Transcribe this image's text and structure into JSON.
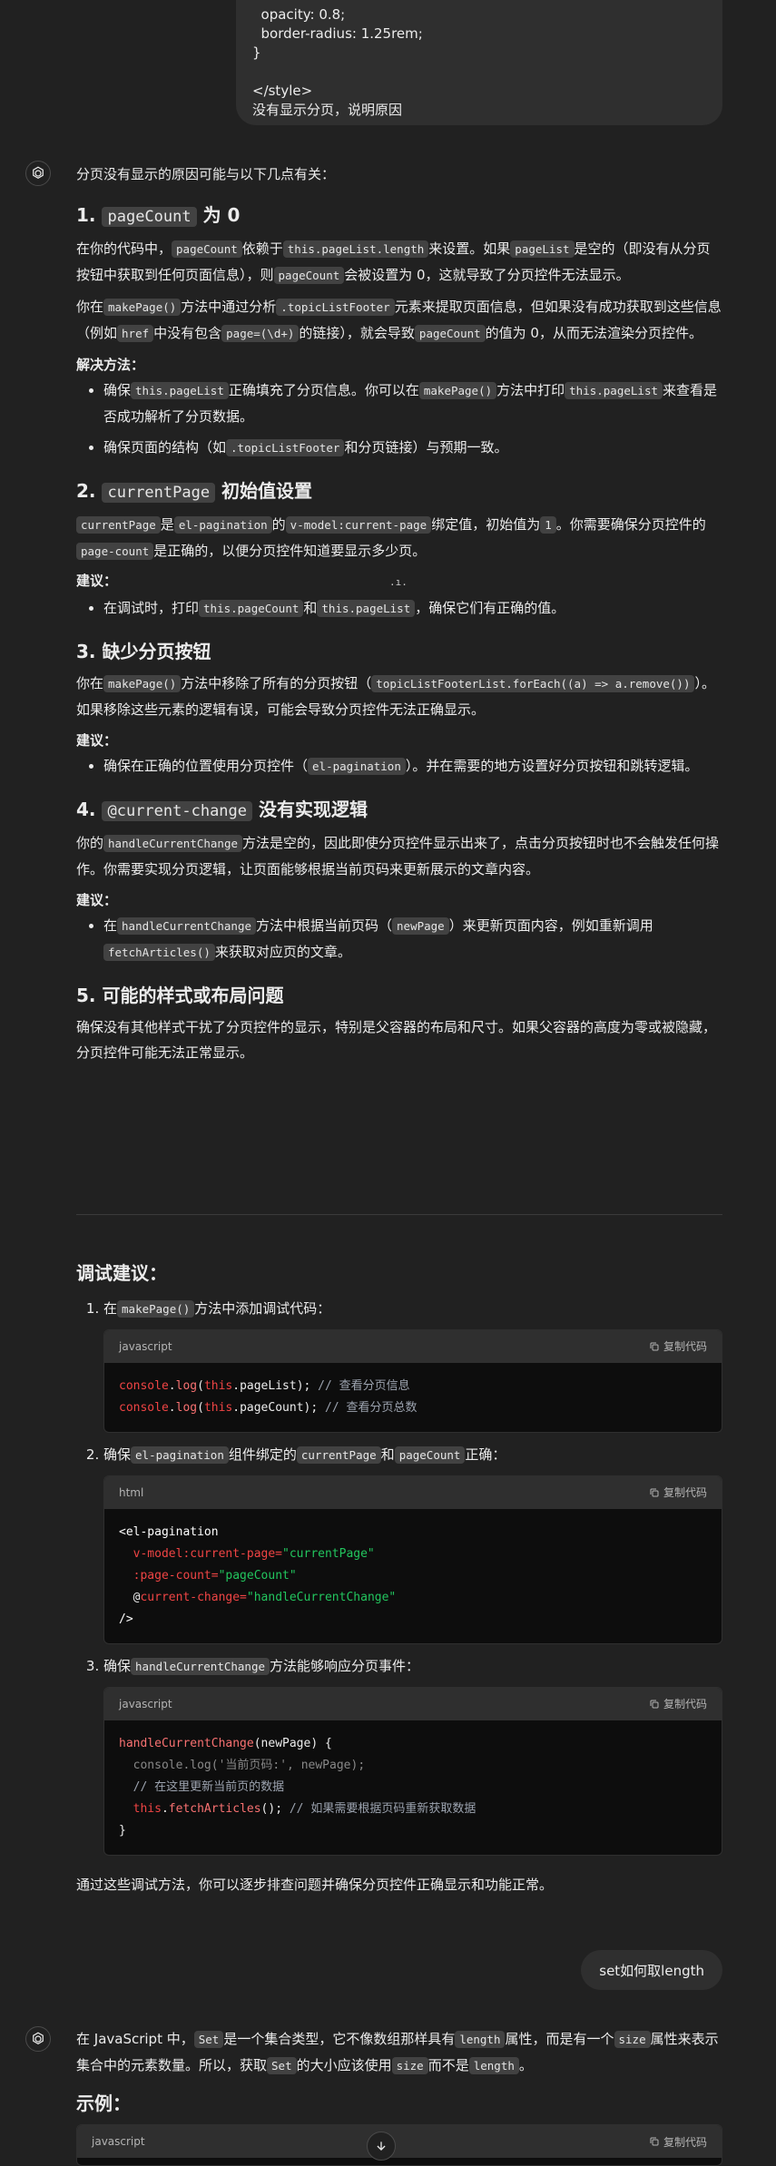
{
  "user_message": {
    "lines": [
      "  opacity: 0.8;",
      "  border-radius: 1.25rem;",
      "}",
      "",
      "</style>",
      "没有显示分页，说明原因"
    ]
  },
  "reply1": {
    "intro": "分页没有显示的原因可能与以下几点有关：",
    "s1": {
      "num": "1.",
      "code": "pageCount",
      "title": "为 0",
      "p1": [
        "在你的代码中，",
        "pageCount",
        "依赖于",
        "this.pageList.length",
        "来设置。如果",
        "pageList",
        "是空的（即没有从分页按钮中获取到任何页面信息），则",
        "pageCount",
        "会被设置为 0，这就导致了分页控件无法显示。"
      ],
      "p2": [
        "你在",
        "makePage()",
        "方法中通过分析",
        ".topicListFooter",
        "元素来提取页面信息，但如果没有成功获取到这些信息（例如",
        "href",
        "中没有包含",
        "page=(\\d+)",
        "的链接），就会导致",
        "pageCount",
        "的值为 0，从而无法渲染分页控件。"
      ],
      "label": "解决方法：",
      "b1": [
        "确保",
        "this.pageList",
        "正确填充了分页信息。你可以在",
        "makePage()",
        "方法中打印",
        "this.pageList",
        "来查看是否成功解析了分页数据。"
      ],
      "b2": [
        "确保页面的结构（如",
        ".topicListFooter",
        "和分页链接）与预期一致。"
      ]
    },
    "s2": {
      "num": "2.",
      "code": "currentPage",
      "title": "初始值设置",
      "p1": [
        "currentPage",
        "是",
        "el-pagination",
        "的",
        "v-model:current-page",
        "绑定值，初始值为",
        "1",
        "。你需要确保分页控件的",
        "page-count",
        "是正确的，以便分页控件知道要显示多少页。"
      ],
      "label": "建议：",
      "b1": [
        "在调试时，打印",
        "this.pageCount",
        "和",
        "this.pageList",
        "，确保它们有正确的值。"
      ]
    },
    "s3": {
      "title": "3. 缺少分页按钮",
      "p1": [
        "你在",
        "makePage()",
        "方法中移除了所有的分页按钮（",
        "topicListFooterList.forEach((a) => a.remove())",
        "）。如果移除这些元素的逻辑有误，可能会导致分页控件无法正确显示。"
      ],
      "label": "建议：",
      "b1": [
        "确保在正确的位置使用分页控件（",
        "el-pagination",
        "）。并在需要的地方设置好分页按钮和跳转逻辑。"
      ]
    },
    "s4": {
      "num": "4.",
      "code": "@current-change",
      "title": "没有实现逻辑",
      "p1": [
        "你的",
        "handleCurrentChange",
        "方法是空的，因此即使分页控件显示出来了，点击分页按钮时也不会触发任何操作。你需要实现分页逻辑，让页面能够根据当前页码来更新展示的文章内容。"
      ],
      "label": "建议：",
      "b1": [
        "在",
        "handleCurrentChange",
        "方法中根据当前页码（",
        "newPage",
        "）来更新页面内容，例如重新调用",
        "fetchArticles()",
        "来获取对应页的文章。"
      ]
    },
    "s5": {
      "title": "5. 可能的样式或布局问题",
      "p1": "确保没有其他样式干扰了分页控件的显示，特别是父容器的布局和尺寸。如果父容器的高度为零或被隐藏，分页控件可能无法正常显示。"
    },
    "debug": {
      "title": "调试建议：",
      "i1": [
        "在",
        "makePage()",
        "方法中添加调试代码："
      ],
      "i2": [
        "确保",
        "el-pagination",
        "组件绑定的",
        "currentPage",
        "和",
        "pageCount",
        "正确："
      ],
      "i3": [
        "确保",
        "handleCurrentChange",
        "方法能够响应分页事件："
      ],
      "code1_lang": "javascript",
      "code2_lang": "html",
      "code3_lang": "javascript",
      "copy_label": "复制代码",
      "code1": {
        "l1": [
          "console",
          ".",
          "log",
          "(",
          "this",
          ".pageList); ",
          "// 查看分页信息"
        ],
        "l2": [
          "console",
          ".",
          "log",
          "(",
          "this",
          ".pageCount); ",
          "// 查看分页总数"
        ]
      },
      "code2": {
        "l1": "<el-pagination",
        "l2a": "  v-model:current-page=",
        "l2b": "\"currentPage\"",
        "l3a": "  :page-count=",
        "l3b": "\"pageCount\"",
        "l4a": "  @",
        "l4b": "current-change=",
        "l4c": "\"handleCurrentChange\"",
        "l5": "/>"
      },
      "code3": {
        "l1a": "handleCurrentChange",
        "l1b": "(newPage) {",
        "l2": "  console.log('当前页码:', newPage);",
        "l3": "  // 在这里更新当前页的数据",
        "l4a": "  this",
        "l4b": ".",
        "l4c": "fetchArticles",
        "l4d": "(); ",
        "l4e": "// 如果需要根据页码重新获取数据",
        "l5": "}"
      },
      "outro": "通过这些调试方法，你可以逐步排查问题并确保分页控件正确显示和功能正常。"
    }
  },
  "user_message2": "set如何取length",
  "reply2": {
    "p1": [
      "在 JavaScript 中，",
      "Set",
      "是一个集合类型，它不像数组那样具有",
      "length",
      "属性，而是有一个",
      "size",
      "属性来表示集合中的元素数量。所以，获取",
      "Set",
      "的大小应该使用",
      "size",
      "而不是",
      "length",
      "。"
    ],
    "example_title": "示例：",
    "code_lang": "javascript",
    "copy_label": "复制代码"
  },
  "misc": {
    "cursor_dots": ".ı."
  }
}
